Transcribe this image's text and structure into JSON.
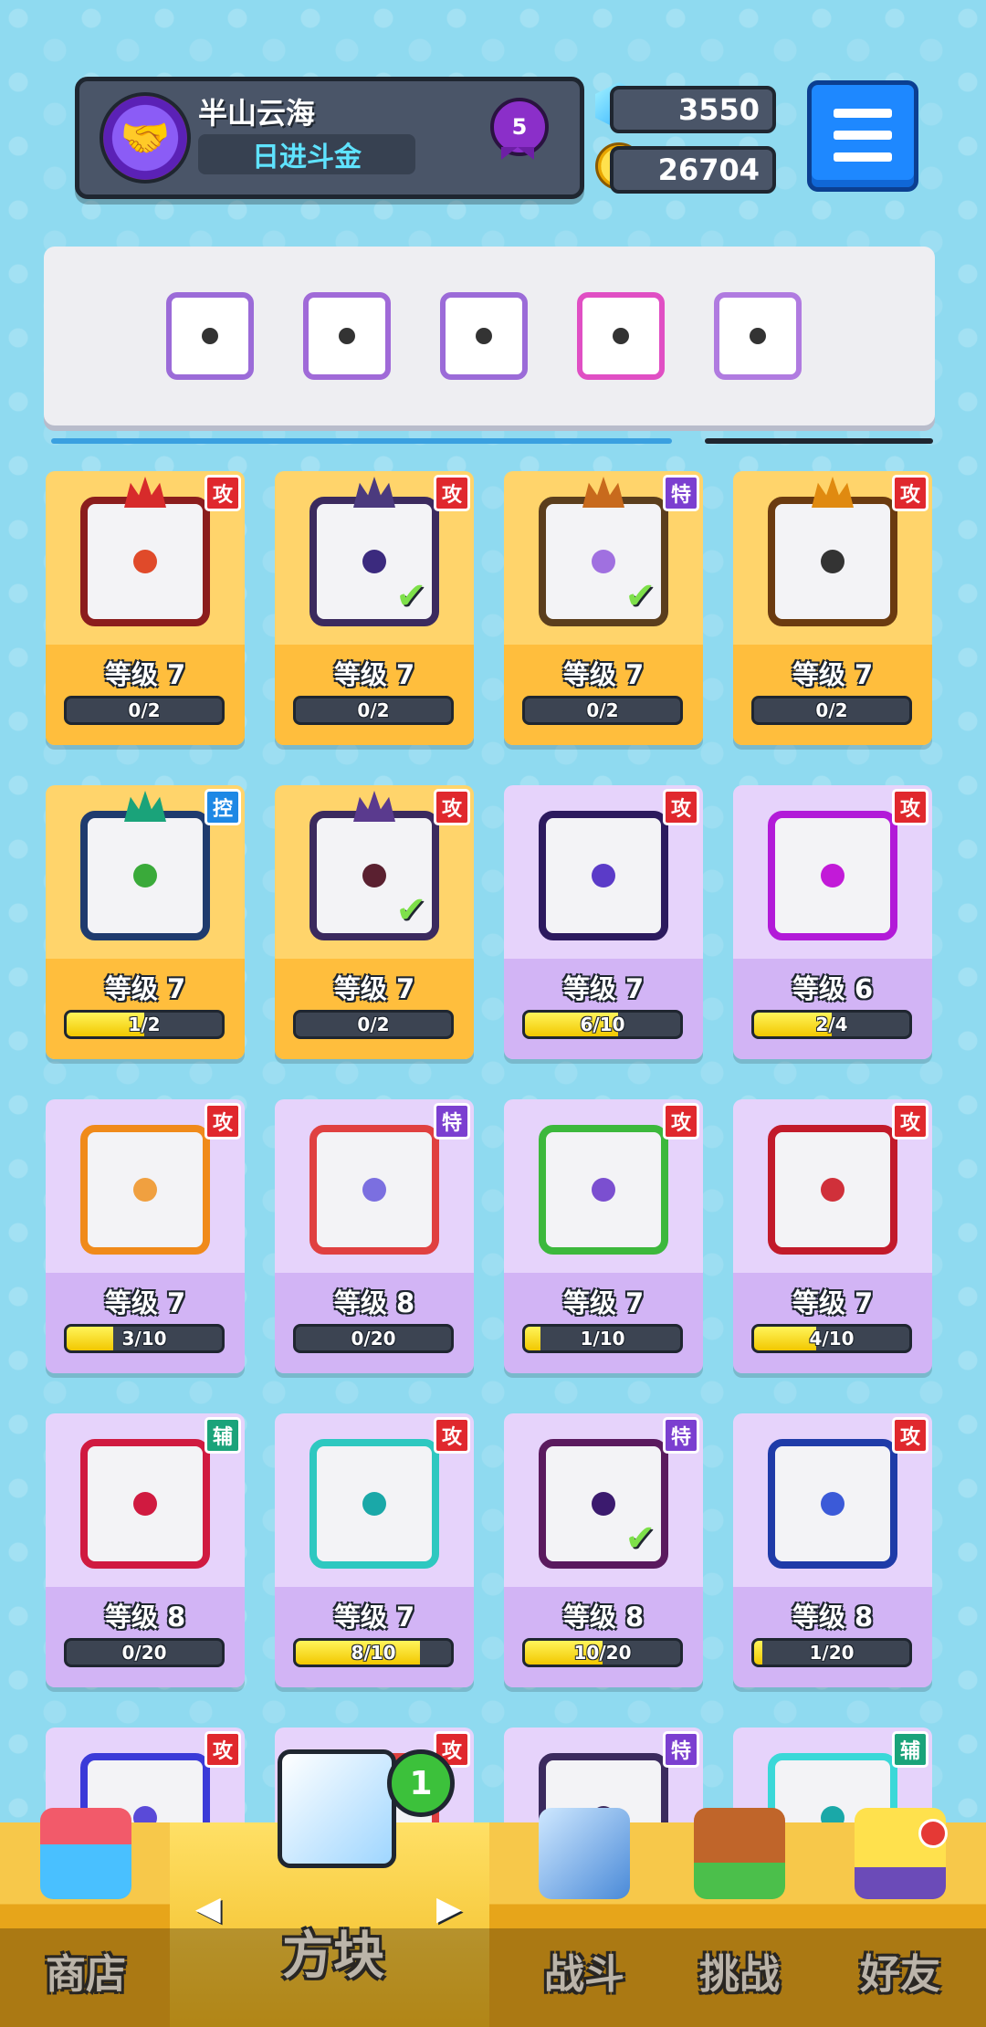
{
  "header": {
    "player_name": "半山云海",
    "player_title": "日进斗金",
    "rank_level": "5",
    "gems": "3550",
    "coins": "26704"
  },
  "colors": {
    "gold_card": "#ffbe3d",
    "purple_card": "#d2b4f5",
    "accent_blue": "#1e88ff"
  },
  "deck": [
    {
      "icon": "purple-cracked-dice-icon",
      "border": "#9b6bd8"
    },
    {
      "icon": "rainbow-infinity-dice-icon",
      "border": "#a06ad8"
    },
    {
      "icon": "purple-void-dice-icon",
      "border": "#9b6bd8"
    },
    {
      "icon": "pink-arrow-dice-icon",
      "border": "#e04fc4"
    },
    {
      "icon": "purple-star-dice-icon",
      "border": "#b07be0"
    }
  ],
  "cards": [
    {
      "rarity": "gold",
      "tag": "攻",
      "tag_color": "#e0282d",
      "level": "等级 7",
      "progress": "0/2",
      "fill": 0,
      "tile_border": "#8b1d1d",
      "pip": "#e04a2a",
      "owned": false,
      "crown": "#d72b2b"
    },
    {
      "rarity": "gold",
      "tag": "攻",
      "tag_color": "#e0282d",
      "level": "等级 7",
      "progress": "0/2",
      "fill": 0,
      "tile_border": "#3b2a5e",
      "pip": "#3b2a7e",
      "owned": true,
      "crown": "#4b3a7e"
    },
    {
      "rarity": "gold",
      "tag": "特",
      "tag_color": "#7b3fd0",
      "level": "等级 7",
      "progress": "0/2",
      "fill": 0,
      "tile_border": "#5b3e1d",
      "pip": "#a070e0",
      "owned": true,
      "crown": "#c86a1d"
    },
    {
      "rarity": "gold",
      "tag": "攻",
      "tag_color": "#e0282d",
      "level": "等级 7",
      "progress": "0/2",
      "fill": 0,
      "tile_border": "#6b3b10",
      "pip": "#333333",
      "owned": false,
      "crown": "#e08a10"
    },
    {
      "rarity": "gold",
      "tag": "控",
      "tag_color": "#1e88e5",
      "level": "等级 7",
      "progress": "1/2",
      "fill": 0.5,
      "tile_border": "#1f3b6e",
      "pip": "#3aaa3a",
      "owned": false,
      "crown": "#1aa37a"
    },
    {
      "rarity": "gold",
      "tag": "攻",
      "tag_color": "#e0282d",
      "level": "等级 7",
      "progress": "0/2",
      "fill": 0,
      "tile_border": "#3b2a5e",
      "pip": "#5a2030",
      "owned": true,
      "crown": "#5a3a8e"
    },
    {
      "rarity": "purple",
      "tag": "攻",
      "tag_color": "#e0282d",
      "level": "等级 7",
      "progress": "6/10",
      "fill": 0.6,
      "tile_border": "#2c1a5e",
      "pip": "#5b3bc8",
      "owned": false,
      "crown": ""
    },
    {
      "rarity": "purple",
      "tag": "攻",
      "tag_color": "#e0282d",
      "level": "等级 6",
      "progress": "2/4",
      "fill": 0.5,
      "tile_border": "#b21ad8",
      "pip": "#c21ad8",
      "owned": false,
      "crown": ""
    },
    {
      "rarity": "purple",
      "tag": "攻",
      "tag_color": "#e0282d",
      "level": "等级 7",
      "progress": "3/10",
      "fill": 0.3,
      "tile_border": "#f08a1a",
      "pip": "#f0a040",
      "owned": false,
      "crown": ""
    },
    {
      "rarity": "purple",
      "tag": "特",
      "tag_color": "#7b3fd0",
      "level": "等级 8",
      "progress": "0/20",
      "fill": 0,
      "tile_border": "#e04040",
      "pip": "#7b6fe0",
      "owned": false,
      "crown": ""
    },
    {
      "rarity": "purple",
      "tag": "攻",
      "tag_color": "#e0282d",
      "level": "等级 7",
      "progress": "1/10",
      "fill": 0.1,
      "tile_border": "#3cb83c",
      "pip": "#7b4fd0",
      "owned": false,
      "crown": ""
    },
    {
      "rarity": "purple",
      "tag": "攻",
      "tag_color": "#e0282d",
      "level": "等级 7",
      "progress": "4/10",
      "fill": 0.4,
      "tile_border": "#c21a2a",
      "pip": "#d0303a",
      "owned": false,
      "crown": ""
    },
    {
      "rarity": "purple",
      "tag": "辅",
      "tag_color": "#1aa37a",
      "level": "等级 8",
      "progress": "0/20",
      "fill": 0,
      "tile_border": "#d01a40",
      "pip": "#d01a40",
      "owned": false,
      "crown": ""
    },
    {
      "rarity": "purple",
      "tag": "攻",
      "tag_color": "#e0282d",
      "level": "等级 7",
      "progress": "8/10",
      "fill": 0.8,
      "tile_border": "#2ec8c0",
      "pip": "#1aa8a8",
      "owned": false,
      "crown": ""
    },
    {
      "rarity": "purple",
      "tag": "特",
      "tag_color": "#7b3fd0",
      "level": "等级 8",
      "progress": "10/20",
      "fill": 0.5,
      "tile_border": "#5a1a5e",
      "pip": "#3b1a6e",
      "owned": true,
      "crown": ""
    },
    {
      "rarity": "purple",
      "tag": "攻",
      "tag_color": "#e0282d",
      "level": "等级 8",
      "progress": "1/20",
      "fill": 0.05,
      "tile_border": "#1f3ba8",
      "pip": "#3b5ad8",
      "owned": false,
      "crown": ""
    },
    {
      "rarity": "purple",
      "tag": "攻",
      "tag_color": "#e0282d",
      "level": "",
      "progress": "",
      "fill": 0,
      "tile_border": "#3b3ad8",
      "pip": "#5a4ad8",
      "owned": false,
      "crown": ""
    },
    {
      "rarity": "purple",
      "tag": "攻",
      "tag_color": "#e0282d",
      "level": "",
      "progress": "",
      "fill": 0,
      "tile_border": "#e04040",
      "pip": "#e04040",
      "owned": false,
      "crown": ""
    },
    {
      "rarity": "purple",
      "tag": "特",
      "tag_color": "#7b3fd0",
      "level": "",
      "progress": "",
      "fill": 0,
      "tile_border": "#3b2a5e",
      "pip": "#3b2a5e",
      "owned": false,
      "crown": ""
    },
    {
      "rarity": "purple",
      "tag": "辅",
      "tag_color": "#1aa37a",
      "level": "",
      "progress": "",
      "fill": 0,
      "tile_border": "#3ad8d8",
      "pip": "#1aa8a8",
      "owned": false,
      "crown": ""
    }
  ],
  "nav": {
    "shop": "商店",
    "dice": "方块",
    "battle": "战斗",
    "challenge": "挑战",
    "friends": "好友",
    "dice_badge": "1",
    "prev_arrow": "◀",
    "next_arrow": "▶"
  }
}
